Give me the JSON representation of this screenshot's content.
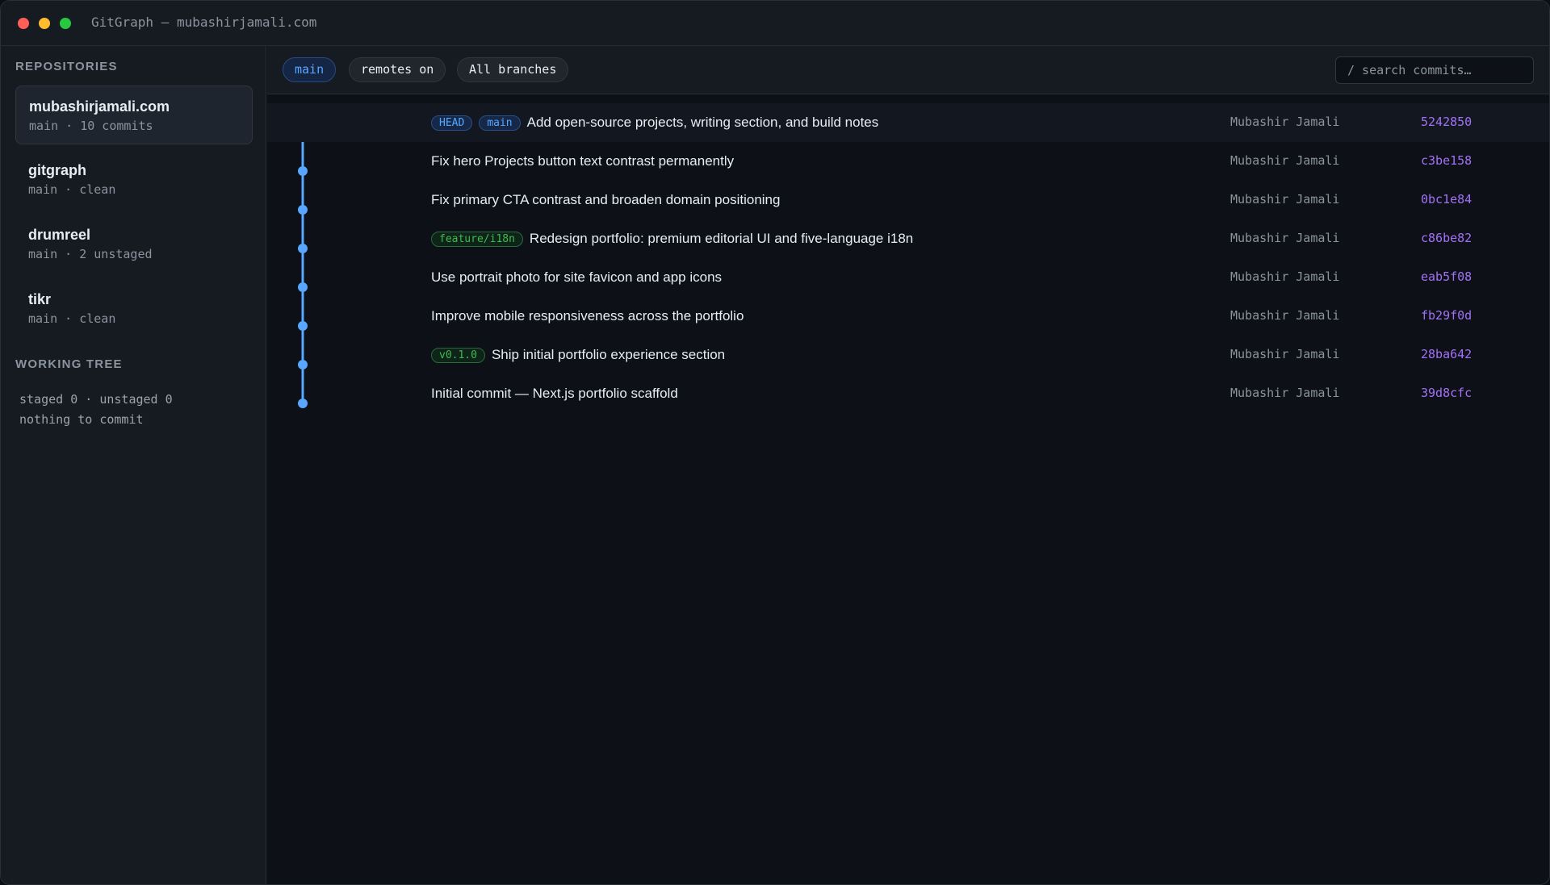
{
  "window": {
    "title": "GitGraph — mubashirjamali.com",
    "controls": [
      "close-icon",
      "minimize-icon",
      "maximize-icon"
    ]
  },
  "sidebar": {
    "repositories_label": "REPOSITORIES",
    "repositories": [
      {
        "name": "mubashirjamali.com",
        "meta": "main · 10 commits",
        "active": true
      },
      {
        "name": "gitgraph",
        "meta": "main · clean",
        "active": false
      },
      {
        "name": "drumreel",
        "meta": "main · 2 unstaged",
        "active": false
      },
      {
        "name": "tikr",
        "meta": "main · clean",
        "active": false
      }
    ],
    "working_tree_label": "WORKING TREE",
    "working_tree": {
      "status": "staged 0 · unstaged 0",
      "message": "nothing to commit"
    }
  },
  "toolbar": {
    "filters": [
      {
        "label": "main",
        "active": true
      },
      {
        "label": "remotes on",
        "active": false
      },
      {
        "label": "All branches",
        "active": false
      }
    ],
    "search_placeholder": "/ search commits…"
  },
  "commits": [
    {
      "refs": [
        {
          "label": "HEAD",
          "kind": "head"
        },
        {
          "label": "main",
          "kind": "branch"
        }
      ],
      "message": "Add open-source projects, writing section, and build notes",
      "author": "Mubashir Jamali",
      "sha": "5242850"
    },
    {
      "refs": [],
      "message": "Fix hero Projects button text contrast permanently",
      "author": "Mubashir Jamali",
      "sha": "c3be158"
    },
    {
      "refs": [],
      "message": "Fix primary CTA contrast and broaden domain positioning",
      "author": "Mubashir Jamali",
      "sha": "0bc1e84"
    },
    {
      "refs": [
        {
          "label": "feature/i18n",
          "kind": "feature"
        }
      ],
      "message": "Redesign portfolio: premium editorial UI and five-language i18n",
      "author": "Mubashir Jamali",
      "sha": "c86be82"
    },
    {
      "refs": [],
      "message": "Use portrait photo for site favicon and app icons",
      "author": "Mubashir Jamali",
      "sha": "eab5f08"
    },
    {
      "refs": [],
      "message": "Improve mobile responsiveness across the portfolio",
      "author": "Mubashir Jamali",
      "sha": "fb29f0d"
    },
    {
      "refs": [
        {
          "label": "v0.1.0",
          "kind": "tag"
        }
      ],
      "message": "Ship initial portfolio experience section",
      "author": "Mubashir Jamali",
      "sha": "28ba642"
    },
    {
      "refs": [],
      "message": "Initial commit — Next.js portfolio scaffold",
      "author": "Mubashir Jamali",
      "sha": "39d8cfc"
    }
  ],
  "colors": {
    "graph_line": "#58a6ff",
    "sha": "#a371f7",
    "ref_blue": "#58a6ff",
    "ref_green": "#3fb950"
  }
}
